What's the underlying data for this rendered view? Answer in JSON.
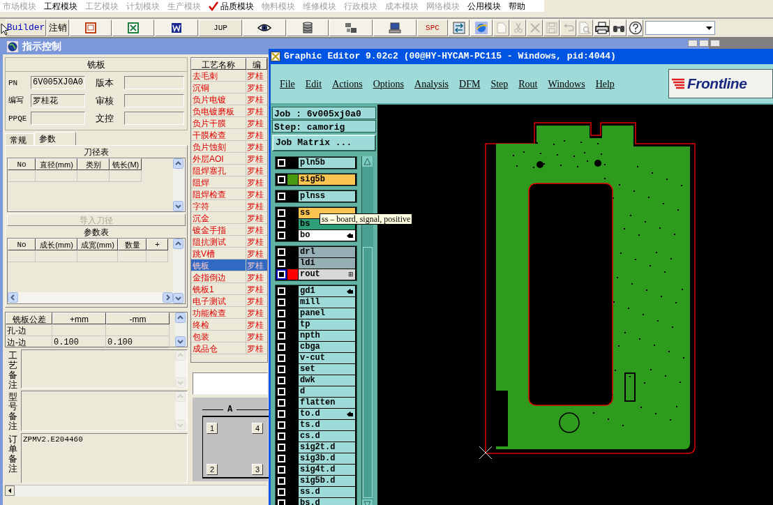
{
  "menu": [
    {
      "label": "市场模块",
      "enabled": false,
      "checked": false
    },
    {
      "label": "工程模块",
      "enabled": true,
      "checked": false
    },
    {
      "label": "工艺模块",
      "enabled": false,
      "checked": false
    },
    {
      "label": "计划模块",
      "enabled": false,
      "checked": false
    },
    {
      "label": "生产模块",
      "enabled": false,
      "checked": false
    },
    {
      "label": "品质模块",
      "enabled": true,
      "checked": true
    },
    {
      "label": "物料模块",
      "enabled": false,
      "checked": false
    },
    {
      "label": "维修模块",
      "enabled": false,
      "checked": false
    },
    {
      "label": "行政模块",
      "enabled": false,
      "checked": false
    },
    {
      "label": "成本模块",
      "enabled": false,
      "checked": false
    },
    {
      "label": "网络模块",
      "enabled": false,
      "checked": false
    },
    {
      "label": "公用模块",
      "enabled": true,
      "checked": false
    },
    {
      "label": "帮助",
      "enabled": true,
      "checked": false
    }
  ],
  "toolbar": [
    {
      "kind": "link",
      "label": "Builder",
      "disabled": false
    },
    {
      "kind": "text",
      "label": "注销",
      "disabled": false
    },
    {
      "kind": "slides",
      "disabled": false
    },
    {
      "kind": "sheet",
      "disabled": false
    },
    {
      "kind": "doc",
      "disabled": false
    },
    {
      "kind": "text",
      "label": "JUP",
      "disabled": false
    },
    {
      "kind": "eye",
      "disabled": false
    },
    {
      "kind": "database",
      "disabled": false
    },
    {
      "kind": "network",
      "disabled": false
    },
    {
      "kind": "monitor",
      "disabled": false
    },
    {
      "kind": "red-text",
      "label": "SPC",
      "disabled": false
    },
    {
      "kind": "transfer",
      "disabled": false
    },
    {
      "kind": "globe",
      "disabled": false
    },
    {
      "kind": "new",
      "disabled": true
    },
    {
      "kind": "cut",
      "disabled": true
    },
    {
      "kind": "delete",
      "disabled": true
    },
    {
      "kind": "save",
      "disabled": true
    },
    {
      "kind": "undo",
      "disabled": true
    },
    {
      "kind": "preview",
      "disabled": true
    },
    {
      "kind": "print",
      "disabled": false
    },
    {
      "kind": "find",
      "disabled": false
    },
    {
      "kind": "help",
      "disabled": false
    },
    {
      "kind": "combo",
      "disabled": false
    }
  ],
  "control_window": {
    "title": "指示控制",
    "header": "铣板",
    "fields": [
      {
        "label": "PN",
        "value": "6V005XJ0A0"
      },
      {
        "label": "版本"
      },
      {
        "label": "编写",
        "value": "罗桂花"
      },
      {
        "label": "审核"
      },
      {
        "label": "PPQE"
      },
      {
        "label": "文控"
      }
    ],
    "tabs": [
      {
        "label": "常规",
        "selected": false
      },
      {
        "label": "参数",
        "selected": true
      }
    ],
    "cutter_table": {
      "title": "刀径表",
      "columns": [
        "No",
        "直径(mm)",
        "类别",
        "铣长(M)"
      ]
    },
    "import_button": {
      "label": "导入刀径",
      "disabled": true
    },
    "param_table": {
      "title": "参数表",
      "columns": [
        "No",
        "成长(mm)",
        "成宽(mm)",
        "数量",
        "+"
      ]
    },
    "tolerance_table": {
      "columns": [
        "铣板公差",
        "+mm",
        "-mm"
      ],
      "rows": [
        [
          "孔-边"
        ],
        [
          "边-边",
          "0.100",
          "0.100"
        ]
      ]
    },
    "notes": [
      {
        "label": "工艺备注"
      },
      {
        "label": "型号备注"
      },
      {
        "label": "订单备注",
        "value": "ZPMV2.E204460"
      }
    ],
    "process_table": {
      "columns": [
        "工艺名称",
        "编"
      ],
      "rows": [
        {
          "name": "去毛刺",
          "author": "罗桂",
          "selected": false
        },
        {
          "name": "沉铜",
          "author": "罗桂",
          "selected": false
        },
        {
          "name": "负片电镀",
          "author": "罗桂",
          "selected": false
        },
        {
          "name": "负电镀磨板",
          "author": "罗桂",
          "selected": false
        },
        {
          "name": "负片干膜",
          "author": "罗桂",
          "selected": false
        },
        {
          "name": "干膜检查",
          "author": "罗桂",
          "selected": false
        },
        {
          "name": "负片蚀刻",
          "author": "罗桂",
          "selected": false
        },
        {
          "name": "外层AOI",
          "author": "罗桂",
          "selected": false
        },
        {
          "name": "阻焊塞孔",
          "author": "罗桂",
          "selected": false
        },
        {
          "name": "阻焊",
          "author": "罗桂",
          "selected": false
        },
        {
          "name": "阻焊检查",
          "author": "罗桂",
          "selected": false
        },
        {
          "name": "字符",
          "author": "罗桂",
          "selected": false
        },
        {
          "name": "沉金",
          "author": "罗桂",
          "selected": false
        },
        {
          "name": "镀金手指",
          "author": "罗桂",
          "selected": false
        },
        {
          "name": "阻抗测试",
          "author": "罗桂",
          "selected": false
        },
        {
          "name": "跳V槽",
          "author": "罗桂",
          "selected": false
        },
        {
          "name": "铣板",
          "author": "罗桂",
          "selected": true
        },
        {
          "name": "金指倒边",
          "author": "罗桂",
          "selected": false
        },
        {
          "name": "铣板1",
          "author": "罗桂",
          "selected": false
        },
        {
          "name": "电子测试",
          "author": "罗桂",
          "selected": false
        },
        {
          "name": "功能检查",
          "author": "罗桂",
          "selected": false
        },
        {
          "name": "终检",
          "author": "罗桂",
          "selected": false
        },
        {
          "name": "包装",
          "author": "罗桂",
          "selected": false
        },
        {
          "name": "成品仓",
          "author": "罗桂",
          "selected": false
        }
      ]
    },
    "panel_layout": {
      "label": "A",
      "buttons": [
        "1",
        "4",
        "2",
        "3"
      ]
    }
  },
  "graphic_editor": {
    "title": "Graphic Editor 9.02c2 (00@HY-HYCAM-PC115 - Windows, pid:4044)",
    "menus": [
      "File",
      "Edit",
      "Actions",
      "Options",
      "Analysis",
      "DFM",
      "Step",
      "Rout",
      "Windows",
      "Help"
    ],
    "logo": "Frontline",
    "job": "Job : 6v005xj0a0",
    "step": "Step: camorig",
    "matrix_button": "Job Matrix ...",
    "layer_groups": [
      {
        "layers": [
          {
            "name": "pln5b",
            "kind": "plane",
            "active": false,
            "pointer": false
          }
        ]
      },
      {
        "layers": [
          {
            "name": "sig5b",
            "kind": "signal",
            "color": "#4a9a10",
            "active": false,
            "pointer": false
          }
        ]
      },
      {
        "layers": [
          {
            "name": "plnss",
            "kind": "plane",
            "active": false,
            "pointer": false
          }
        ]
      },
      {
        "layers": [
          {
            "name": "ss",
            "kind": "signal",
            "active": false,
            "pointer": false
          },
          {
            "name": "bs",
            "kind": "mask",
            "active": false,
            "pointer": false
          },
          {
            "name": "bo",
            "kind": "outline",
            "active": false,
            "pointer": true
          }
        ]
      },
      {
        "layers": [
          {
            "name": "drl",
            "kind": "drill",
            "active": false,
            "pointer": false
          },
          {
            "name": "ldi",
            "kind": "drill",
            "active": false,
            "pointer": false
          },
          {
            "name": "rout",
            "kind": "rout",
            "color": "#ff0000",
            "active": true,
            "pointer": false,
            "glyph": "⊞"
          }
        ]
      },
      {
        "layers": [
          {
            "name": "gd1",
            "kind": "plane",
            "active": false,
            "pointer": true
          },
          {
            "name": "mill",
            "kind": "plane",
            "active": false,
            "pointer": false
          },
          {
            "name": "panel",
            "kind": "plane",
            "active": false,
            "pointer": false
          },
          {
            "name": "tp",
            "kind": "plane",
            "active": false,
            "pointer": false
          },
          {
            "name": "npth",
            "kind": "plane",
            "active": false,
            "pointer": false
          },
          {
            "name": "cbga",
            "kind": "plane",
            "active": false,
            "pointer": false
          },
          {
            "name": "v-cut",
            "kind": "plane",
            "active": false,
            "pointer": false
          },
          {
            "name": "set",
            "kind": "plane",
            "active": false,
            "pointer": false
          },
          {
            "name": "dwk",
            "kind": "plane",
            "active": false,
            "pointer": false
          },
          {
            "name": "d",
            "kind": "plane",
            "active": false,
            "pointer": false
          },
          {
            "name": "flatten",
            "kind": "plane",
            "active": false,
            "pointer": false
          },
          {
            "name": "to.d",
            "kind": "plane",
            "active": false,
            "pointer": true
          },
          {
            "name": "ts.d",
            "kind": "plane",
            "active": false,
            "pointer": false
          },
          {
            "name": "cs.d",
            "kind": "plane",
            "active": false,
            "pointer": false
          },
          {
            "name": "sig2t.d",
            "kind": "plane",
            "active": false,
            "pointer": false
          },
          {
            "name": "sig3b.d",
            "kind": "plane",
            "active": false,
            "pointer": false
          },
          {
            "name": "sig4t.d",
            "kind": "plane",
            "active": false,
            "pointer": false
          },
          {
            "name": "sig5b.d",
            "kind": "plane",
            "active": false,
            "pointer": false
          },
          {
            "name": "ss.d",
            "kind": "plane",
            "active": false,
            "pointer": false
          },
          {
            "name": "bs.d",
            "kind": "plane",
            "active": false,
            "pointer": false
          }
        ]
      }
    ],
    "tooltip": "ss – board, signal, positive"
  }
}
